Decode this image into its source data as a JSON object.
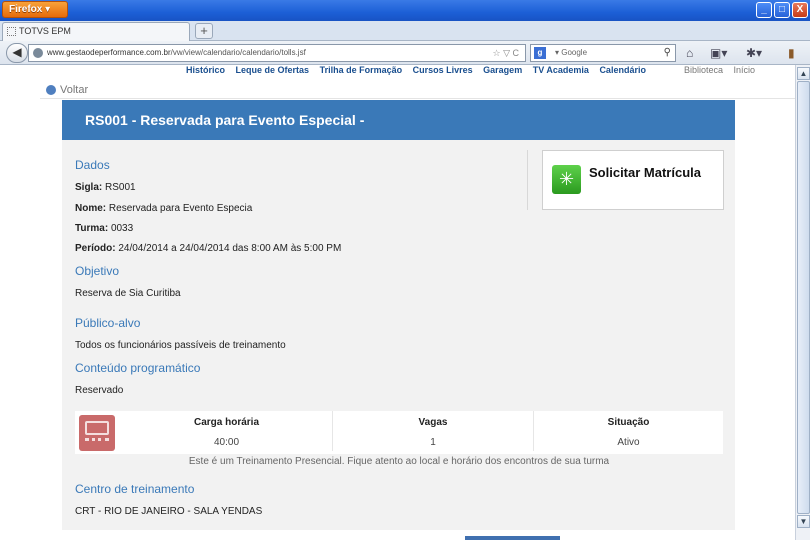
{
  "browser": {
    "menu_button": "Firefox ▾",
    "tab_title": "TOTVS EPM",
    "newtab_label": "+",
    "url_site": "www.gestaodeperformance.com.br",
    "url_path": "/vw/view/calendario/calendario/tolls.jsf",
    "url_icons": "☆ ▽ C",
    "search_engine_label": "g",
    "search_placeholder": "▾ Google",
    "window_controls": [
      "_",
      "□",
      "X"
    ]
  },
  "site_menu": {
    "items": [
      "Histórico",
      "Leque de Ofertas",
      "Trilha de Formação",
      "Cursos Livres",
      "Garagem",
      "TV Academia",
      "Calendário"
    ],
    "right_items": [
      "Biblioteca",
      "Início"
    ]
  },
  "voltar_label": "Voltar",
  "course": {
    "header": "RS001 - Reservada para Evento Especial -",
    "dados_title": "Dados",
    "sigla_label": "Sigla:",
    "sigla_value": "RS001",
    "nome_label": "Nome:",
    "nome_value": "Reservada para Evento Especia",
    "turma_label": "Turma:",
    "turma_value": "0033",
    "periodo_label": "Período:",
    "periodo_value": "24/04/2014 a 24/04/2014 das 8:00 AM às 5:00 PM",
    "objetivo_title": "Objetivo",
    "objetivo_text": "Reserva de Sia Curitiba",
    "publico_title": "Público-alvo",
    "publico_text": "Todos os funcionários passíveis de treinamento",
    "conteudo_title": "Conteúdo programático",
    "conteudo_text": "Reservado",
    "solicitar_label": "Solicitar Matrícula",
    "info": {
      "carga_label": "Carga horária",
      "carga_value": "40:00",
      "vagas_label": "Vagas",
      "vagas_value": "1",
      "situacao_label": "Situação",
      "situacao_value": "Ativo",
      "note": "Este é um Treinamento Presencial. Fique atento ao local e horário dos encontros de sua turma"
    },
    "centro_title": "Centro de treinamento",
    "centro_text": "CRT - RIO DE JANEIRO - SALA YENDAS"
  },
  "colors": {
    "header_bg": "#3a79b8",
    "section_title": "#3a79b8",
    "solicitar_icon": "#2b9a1f"
  },
  "icons": [
    "back-arrow-icon",
    "globe-icon",
    "google-icon",
    "magnifier-icon",
    "home-icon",
    "bookmark-icon",
    "addon-icon",
    "library-icon",
    "voltar-icon",
    "refresh-icon",
    "presencial-training-icon"
  ]
}
